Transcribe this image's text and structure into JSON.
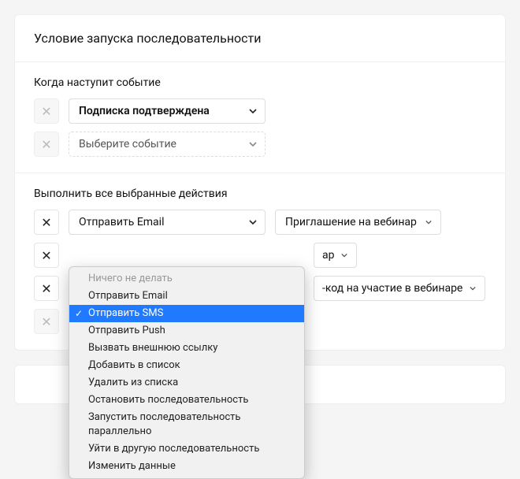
{
  "panel": {
    "title": "Условие запуска последовательности"
  },
  "events": {
    "heading": "Когда наступит событие",
    "confirmed": "Подписка подтверждена",
    "placeholder": "Выберите событие"
  },
  "actions": {
    "heading": "Выполнить все выбранные действия",
    "row1": {
      "action": "Отправить Email",
      "param": "Приглашение на вебинар"
    },
    "row2": {
      "param_tail": "ар"
    },
    "row3": {
      "param_tail": "-код на участие в вебинаре"
    }
  },
  "dropdown": {
    "items": [
      {
        "label": "Ничего не делать",
        "muted": true
      },
      {
        "label": "Отправить Email"
      },
      {
        "label": "Отправить SMS",
        "selected": true
      },
      {
        "label": "Отправить Push"
      },
      {
        "label": "Вызвать внешнюю ссылку"
      },
      {
        "label": "Добавить в список"
      },
      {
        "label": "Удалить из списка"
      },
      {
        "label": "Остановить последовательность"
      },
      {
        "label": "Запустить последовательность параллельно"
      },
      {
        "label": "Уйти в другую последовательность"
      },
      {
        "label": "Изменить данные"
      }
    ]
  },
  "icons": {
    "close": "✕"
  }
}
